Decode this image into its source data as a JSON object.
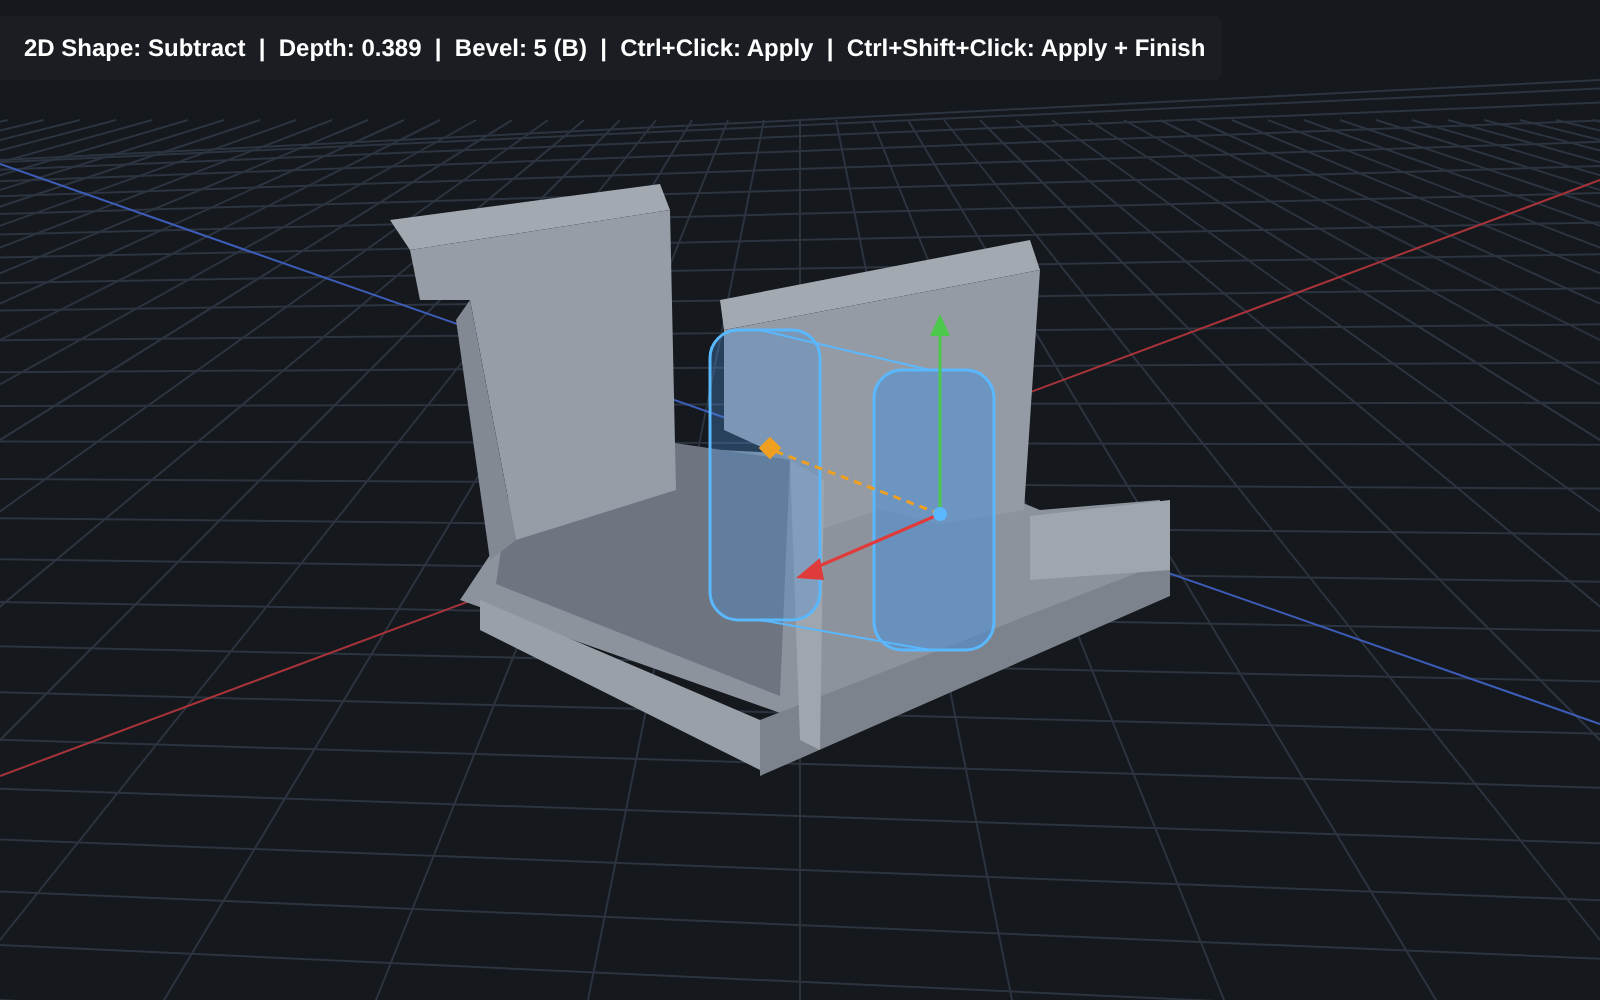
{
  "viewport": {
    "status_text": "2D Shape: Subtract  |  Depth: 0.389  |  Bevel: 5 (B)  |  Ctrl+Click: Apply  |  Ctrl+Shift+Click: Apply + Finish"
  }
}
